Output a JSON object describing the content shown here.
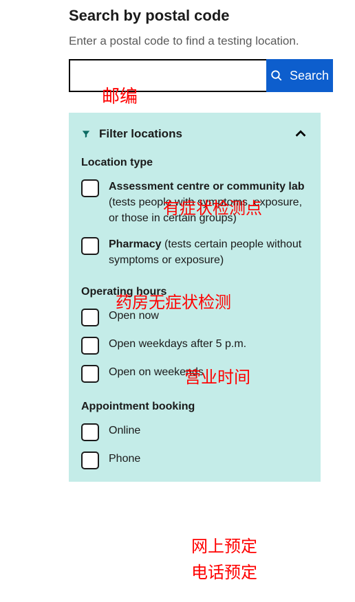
{
  "heading": "Search by postal code",
  "subtext": "Enter a postal code to find a testing location.",
  "search": {
    "value": "",
    "button_label": "Search"
  },
  "panel": {
    "title": "Filter locations",
    "sections": {
      "location_type": {
        "title": "Location type",
        "options": [
          {
            "bold": "Assessment centre or community lab",
            "rest": " (tests people with symptoms, exposure, or those in certain groups)"
          },
          {
            "bold": "Pharmacy",
            "rest": " (tests certain people without symptoms or exposure)"
          }
        ]
      },
      "operating_hours": {
        "title": "Operating hours",
        "options": [
          {
            "label": "Open now"
          },
          {
            "label": "Open weekdays after 5 p.m."
          },
          {
            "label": "Open on weekends"
          }
        ]
      },
      "appointment": {
        "title": "Appointment booking",
        "options": [
          {
            "label": "Online"
          },
          {
            "label": "Phone"
          }
        ]
      }
    }
  },
  "annotations": {
    "postal": "邮编",
    "symptomatic": "有症状检测点",
    "pharmacy": "药房无症状检测",
    "hours": "营业时间",
    "online": "网上预定",
    "phone": "电话预定"
  }
}
